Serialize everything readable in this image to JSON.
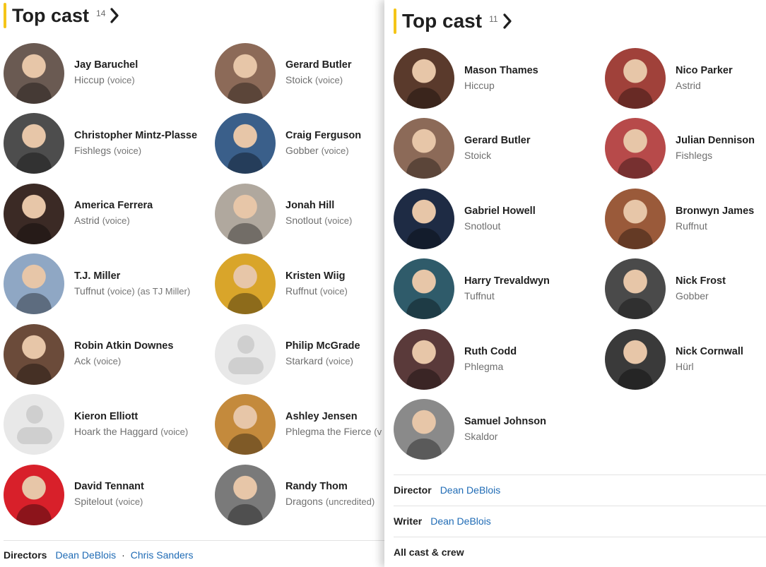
{
  "left": {
    "title": "Top cast",
    "count": "14",
    "cast": [
      {
        "name": "Jay Baruchel",
        "role": "Hiccup",
        "note": "(voice)",
        "photo": "#6a5a52"
      },
      {
        "name": "Gerard Butler",
        "role": "Stoick",
        "note": "(voice)",
        "photo": "#8c6a58"
      },
      {
        "name": "Christopher Mintz-Plasse",
        "role": "Fishlegs",
        "note": "(voice)",
        "photo": "#4d4d4d"
      },
      {
        "name": "Craig Ferguson",
        "role": "Gobber",
        "note": "(voice)",
        "photo": "#3a5f8a"
      },
      {
        "name": "America Ferrera",
        "role": "Astrid",
        "note": "(voice)",
        "photo": "#3b2a25"
      },
      {
        "name": "Jonah Hill",
        "role": "Snotlout",
        "note": "(voice)",
        "photo": "#b0a89e"
      },
      {
        "name": "T.J. Miller",
        "role": "Tuffnut",
        "note": "(voice) (as TJ Miller)",
        "photo": "#8fa7c4"
      },
      {
        "name": "Kristen Wiig",
        "role": "Ruffnut",
        "note": "(voice)",
        "photo": "#d9a52a"
      },
      {
        "name": "Robin Atkin Downes",
        "role": "Ack",
        "note": "(voice)",
        "photo": "#6b4b3a"
      },
      {
        "name": "Philip McGrade",
        "role": "Starkard",
        "note": "(voice)",
        "photo": ""
      },
      {
        "name": "Kieron Elliott",
        "role": "Hoark the Haggard",
        "note": "(voice)",
        "photo": ""
      },
      {
        "name": "Ashley Jensen",
        "role": "Phlegma the Fierce",
        "note": "(v",
        "photo": "#c48a3c"
      },
      {
        "name": "David Tennant",
        "role": "Spitelout",
        "note": "(voice)",
        "photo": "#d8202a"
      },
      {
        "name": "Randy Thom",
        "role": "Dragons",
        "note": "(uncredited)",
        "photo": "#7a7a7a"
      }
    ],
    "credits_label": "Directors",
    "credits": [
      "Dean DeBlois",
      "Chris Sanders"
    ],
    "separator": "·"
  },
  "right": {
    "title": "Top cast",
    "count": "11",
    "cast": [
      {
        "name": "Mason Thames",
        "role": "Hiccup",
        "note": "",
        "photo": "#5a3a2c"
      },
      {
        "name": "Nico Parker",
        "role": "Astrid",
        "note": "",
        "photo": "#a0413a"
      },
      {
        "name": "Gerard Butler",
        "role": "Stoick",
        "note": "",
        "photo": "#8c6a58"
      },
      {
        "name": "Julian Dennison",
        "role": "Fishlegs",
        "note": "",
        "photo": "#b74a4a"
      },
      {
        "name": "Gabriel Howell",
        "role": "Snotlout",
        "note": "",
        "photo": "#1e2b44"
      },
      {
        "name": "Bronwyn James",
        "role": "Ruffnut",
        "note": "",
        "photo": "#9a5a3a"
      },
      {
        "name": "Harry Trevaldwyn",
        "role": "Tuffnut",
        "note": "",
        "photo": "#2f5b6a"
      },
      {
        "name": "Nick Frost",
        "role": "Gobber",
        "note": "",
        "photo": "#4a4a4a"
      },
      {
        "name": "Ruth Codd",
        "role": "Phlegma",
        "note": "",
        "photo": "#5a3a3a"
      },
      {
        "name": "Nick Cornwall",
        "role": "Hürl",
        "note": "",
        "photo": "#3a3a3a"
      },
      {
        "name": "Samuel Johnson",
        "role": "Skaldor",
        "note": "",
        "photo": "#8a8a8a"
      }
    ],
    "director_label": "Director",
    "director": "Dean DeBlois",
    "writer_label": "Writer",
    "writer": "Dean DeBlois",
    "all_cast": "All cast & crew"
  },
  "colors": {
    "accent": "#f5c518",
    "link": "#1f6bb5"
  },
  "icons": {
    "chevron": "chevron-right-icon",
    "placeholder": "person-placeholder-icon"
  }
}
